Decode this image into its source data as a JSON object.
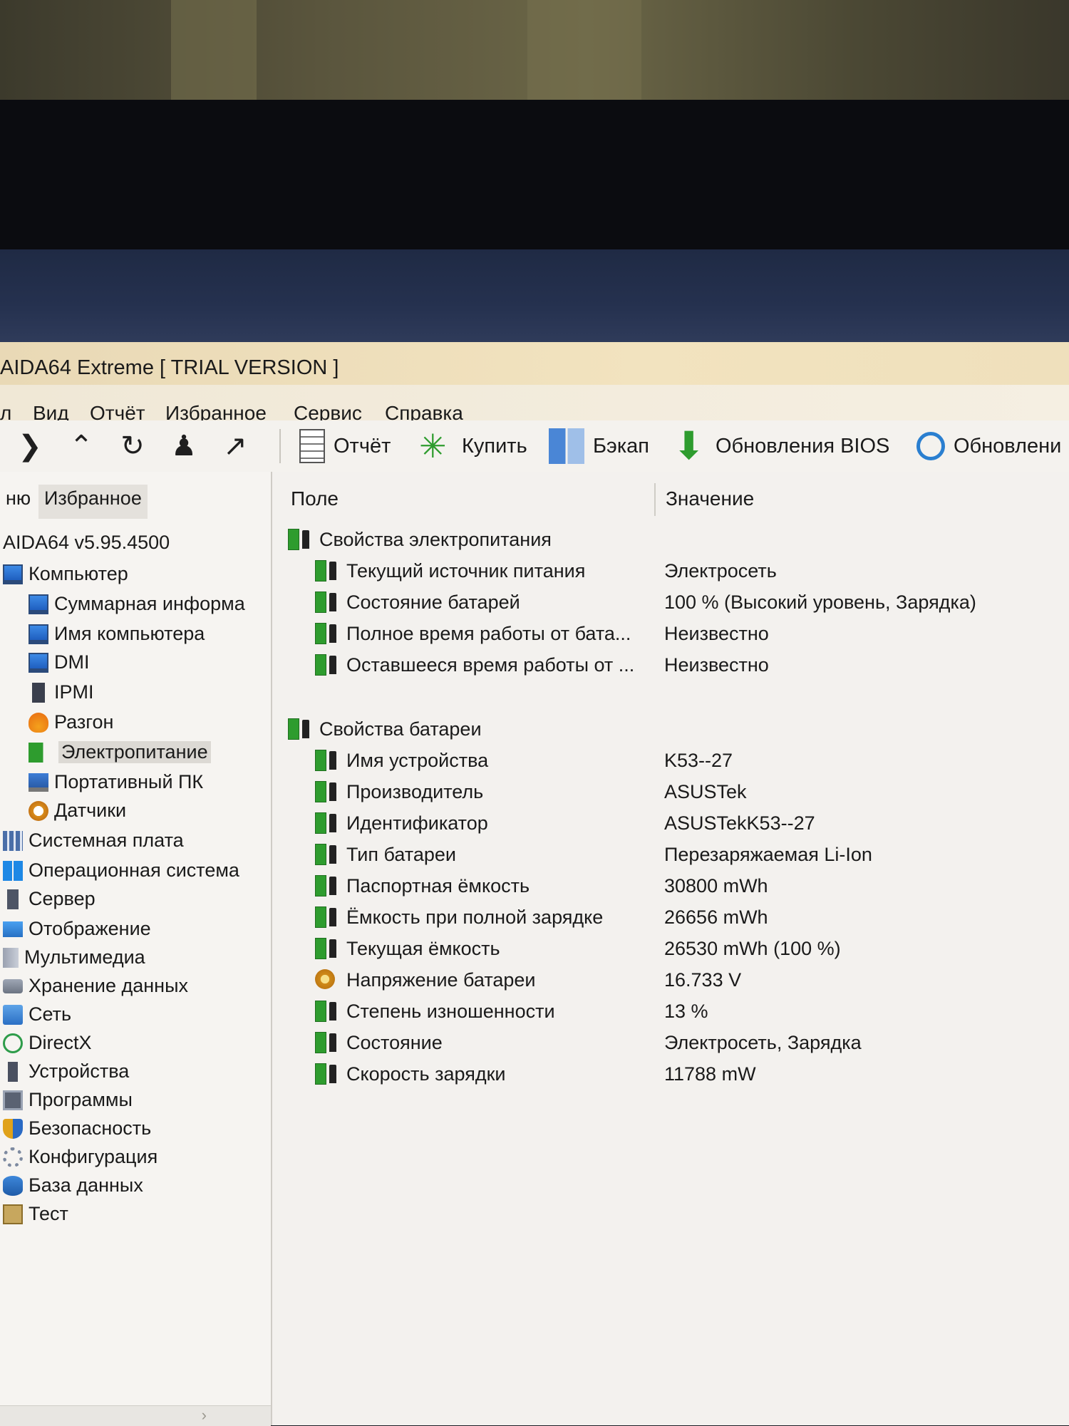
{
  "window": {
    "title": "AIDA64 Extreme  [ TRIAL VERSION ]"
  },
  "menu": [
    "л",
    "Вид",
    "Отчёт",
    "Избранное",
    "Сервис",
    "Справка"
  ],
  "toolbar": {
    "buttons": [
      {
        "label": "Отчёт",
        "icon": "report-icon"
      },
      {
        "label": "Купить",
        "icon": "buy-icon"
      },
      {
        "label": "Бэкап",
        "icon": "backup-icon"
      },
      {
        "label": "Обновления BIOS",
        "icon": "bios-update-icon"
      },
      {
        "label": "Обновлени",
        "icon": "driver-update-icon"
      }
    ]
  },
  "left_tabs": [
    "ню",
    "Избранное"
  ],
  "tree": [
    {
      "label": "AIDA64 v5.95.4500",
      "icon": "",
      "level": 0
    },
    {
      "label": "Компьютер",
      "icon": "monitor",
      "level": 0
    },
    {
      "label": "Суммарная информа",
      "icon": "monitor",
      "level": 1
    },
    {
      "label": "Имя компьютера",
      "icon": "monitor",
      "level": 1
    },
    {
      "label": "DMI",
      "icon": "monitor",
      "level": 1
    },
    {
      "label": "IPMI",
      "icon": "tower",
      "level": 1
    },
    {
      "label": "Разгон",
      "icon": "flame",
      "level": 1
    },
    {
      "label": "Электропитание",
      "icon": "battery",
      "level": 1,
      "selected": true
    },
    {
      "label": "Портативный ПК",
      "icon": "laptop",
      "level": 1
    },
    {
      "label": "Датчики",
      "icon": "gauge",
      "level": 1
    },
    {
      "label": "Системная плата",
      "icon": "board",
      "level": 0
    },
    {
      "label": "Операционная система",
      "icon": "win",
      "level": 0
    },
    {
      "label": "Сервер",
      "icon": "server",
      "level": 0
    },
    {
      "label": "Отображение",
      "icon": "screen",
      "level": 0
    },
    {
      "label": "Мультимедиа",
      "icon": "speaker",
      "level": 0
    },
    {
      "label": "Хранение данных",
      "icon": "disk",
      "level": 0
    },
    {
      "label": "Сеть",
      "icon": "net",
      "level": 0
    },
    {
      "label": "DirectX",
      "icon": "xbox",
      "level": 0
    },
    {
      "label": "Устройства",
      "icon": "usb",
      "level": 0
    },
    {
      "label": "Программы",
      "icon": "app",
      "level": 0
    },
    {
      "label": "Безопасность",
      "icon": "shield",
      "level": 0
    },
    {
      "label": "Конфигурация",
      "icon": "gear",
      "level": 0
    },
    {
      "label": "База данных",
      "icon": "db",
      "level": 0
    },
    {
      "label": "Тест",
      "icon": "test",
      "level": 0
    }
  ],
  "columns": {
    "field": "Поле",
    "value": "Значение"
  },
  "groups": [
    {
      "title": "Свойства электропитания",
      "rows": [
        {
          "field": "Текущий источник питания",
          "value": "Электросеть"
        },
        {
          "field": "Состояние батарей",
          "value": "100 % (Высокий уровень, Зарядка)"
        },
        {
          "field": "Полное время работы от бата...",
          "value": "Неизвестно"
        },
        {
          "field": "Оставшееся время работы от ...",
          "value": "Неизвестно"
        }
      ]
    },
    {
      "title": "Свойства батареи",
      "rows": [
        {
          "field": "Имя устройства",
          "value": "K53--27"
        },
        {
          "field": "Производитель",
          "value": "ASUSTek"
        },
        {
          "field": "Идентификатор",
          "value": "ASUSTekK53--27"
        },
        {
          "field": "Тип батареи",
          "value": "Перезаряжаемая Li-Ion"
        },
        {
          "field": "Паспортная ёмкость",
          "value": "30800 mWh"
        },
        {
          "field": "Ёмкость при полной зарядке",
          "value": "26656 mWh"
        },
        {
          "field": "Текущая ёмкость",
          "value": "26530 mWh  (100 %)"
        },
        {
          "field": "Напряжение батареи",
          "value": "16.733 V",
          "icon": "voltage"
        },
        {
          "field": "Степень изношенности",
          "value": "13 %"
        },
        {
          "field": "Состояние",
          "value": "Электросеть, Зарядка"
        },
        {
          "field": "Скорость зарядки",
          "value": "11788 mW"
        }
      ]
    }
  ]
}
